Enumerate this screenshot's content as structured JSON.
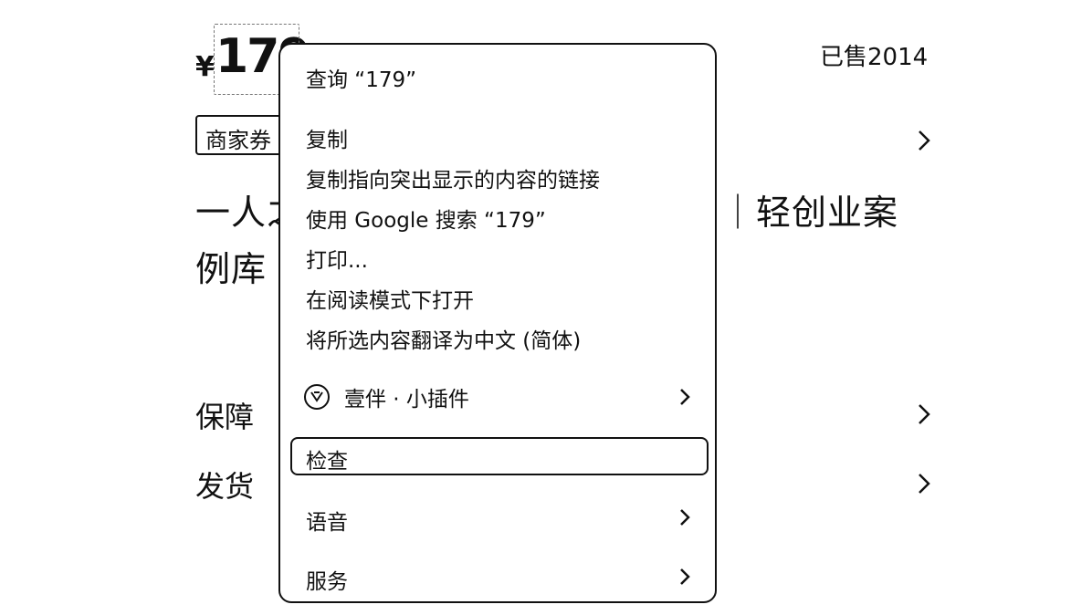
{
  "product": {
    "currency": "¥",
    "price": "179",
    "sold": "已售2014",
    "coupon": "商家券",
    "title_line1_left": "一人之",
    "title_line1_right": "｜轻创业案",
    "title_line2": "例库",
    "guarantee_label": "保障",
    "shipping_label": "发货"
  },
  "context_menu": {
    "lookup": "查询 “179”",
    "copy": "复制",
    "copy_link": "复制指向突出显示的内容的链接",
    "search_google": "使用 Google 搜索 “179”",
    "print": "打印...",
    "reader_mode": "在阅读模式下打开",
    "translate": "将所选内容翻译为中文 (简体)",
    "plugin": "壹伴 · 小插件",
    "inspect": "检查",
    "speech": "语音",
    "services": "服务"
  },
  "icons": {
    "chevron": "chevron-right-icon",
    "plugin_logo": "yiban-logo-icon"
  }
}
